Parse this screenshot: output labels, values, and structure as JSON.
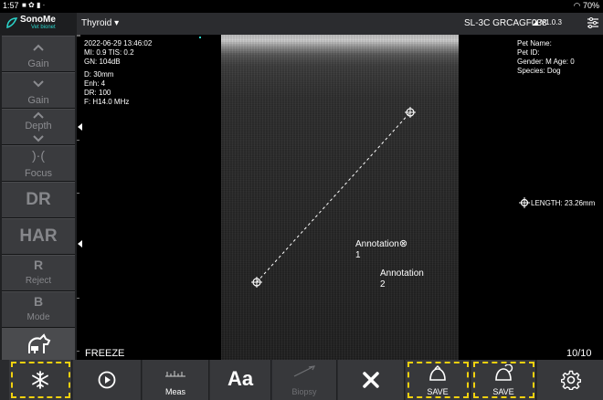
{
  "status_bar": {
    "time": "1:57",
    "battery": "70%"
  },
  "header": {
    "brand": "SonoMe",
    "brand_sub": "Vet bionet",
    "preset": "Thyroid ▾",
    "probe": "SL-3C GRCAGF038",
    "version": "V1.0.3"
  },
  "sidebar": {
    "gain_label": "Gain",
    "gain_label_2": "Gain",
    "depth_label": "Depth",
    "focus_label": "Focus",
    "dr_label": "DR",
    "har_label": "HAR",
    "reject_big": "R",
    "reject_label": "Reject",
    "mode_big": "B",
    "mode_label": "Mode"
  },
  "params": {
    "datetime": "2022-06-29 13:46:02",
    "mi_tis": "MI:  0.9  TIS:  0.2",
    "gn": "GN: 104dB",
    "depth": "D: 30mm",
    "enh": "Enh: 4",
    "dr": "DR: 100",
    "freq": "F: H14.0 MHz"
  },
  "patient": {
    "name": "Pet Name:",
    "id": "Pet ID:",
    "gender_age": "Gender:  M  Age:  0",
    "species": "Species:  Dog"
  },
  "measurement": {
    "length": "LENGTH: 23.26mm"
  },
  "annotations": [
    {
      "text": "Annotation",
      "number": "1"
    },
    {
      "text": "Annotation",
      "number": "2"
    }
  ],
  "freeze_label": "FREEZE",
  "frame_counter": "10/10",
  "toolbar": {
    "meas": "Meas",
    "text": "Aa",
    "biopsy": "Biopsy",
    "save_image": "SAVE",
    "save_clip": "SAVE"
  },
  "colors": {
    "highlight": "#f1d10f",
    "brand_accent": "#2ad3c9"
  }
}
